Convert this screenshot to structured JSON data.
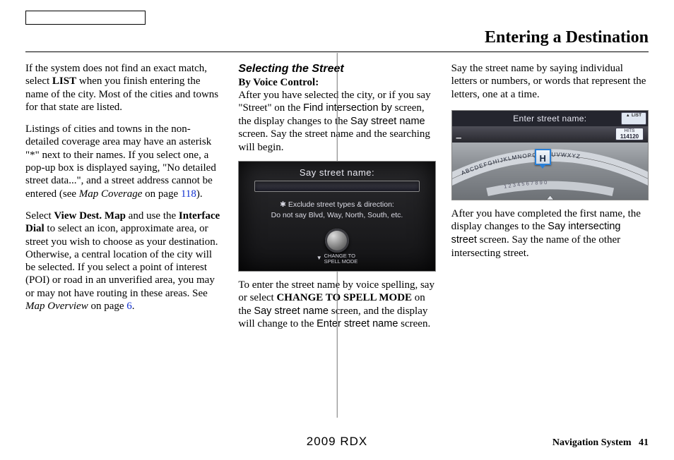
{
  "header": {
    "title": "Entering a Destination"
  },
  "col1": {
    "p1a": "If the system does not find an exact match, select ",
    "p1b": "LIST",
    "p1c": " when you finish entering the name of the city. Most of the cities and towns for that state are listed.",
    "p2a": "Listings of cities and towns in the non-detailed coverage area may have an asterisk \"*\" next to their names. If you select one, a pop-up box is displayed saying, \"No detailed street data...\", and a street address cannot be entered (see ",
    "p2b": "Map Coverage",
    "p2c": " on page ",
    "p2d": "118",
    "p2e": ").",
    "p3a": "Select ",
    "p3b": "View Dest. Map",
    "p3c": " and use the ",
    "p3d": "Interface Dial",
    "p3e": " to select an icon, approximate area, or street you wish to choose as your destination. Otherwise, a central location of the city will be selected. If you select a point of interest (POI) or road in an unverified area, you may or may not have routing in these areas. See ",
    "p3f": "Map Overview",
    "p3g": " on page ",
    "p3h": "6",
    "p3i": "."
  },
  "col2": {
    "sect": "Selecting the Street",
    "sub": "By Voice Control:",
    "p1a": "After you have selected the city, or if you say \"Street\" on the ",
    "p1b": "Find intersection by",
    "p1c": " screen, the display changes to the ",
    "p1d": "Say street name",
    "p1e": " screen. Say the street name and the searching will begin.",
    "shot1": {
      "title": "Say street name:",
      "note1": "✱ Exclude street types & direction:",
      "note2": "Do not say Blvd, Way, North, South, etc.",
      "change": "CHANGE TO\nSPELL MODE"
    },
    "p2a": "To enter the street name by voice spelling, say or select ",
    "p2b": "CHANGE TO SPELL MODE",
    "p2c": " on the ",
    "p2d": "Say street name",
    "p2e": " screen, and the display will change to the ",
    "p2f": "Enter street name",
    "p2g": " screen."
  },
  "col3": {
    "p1": "Say the street name by saying individual letters or numbers, or words that represent the letters, one at a time.",
    "shot2": {
      "title": "Enter street name:",
      "list": "▲ LIST",
      "hits_label": "HITS",
      "hits_value": "114120",
      "input": "_",
      "key": "H",
      "letters": "ABCDEFGHIJKLMNOPQRSTUVWXYZ",
      "numbers": "1234567890"
    },
    "p2a": "After you have completed the first name, the display changes to the ",
    "p2b": "Say intersecting street",
    "p2c": " screen. Say the name of the other intersecting street."
  },
  "footer": {
    "model": "2009  RDX",
    "section": "Navigation System",
    "page": "41"
  }
}
